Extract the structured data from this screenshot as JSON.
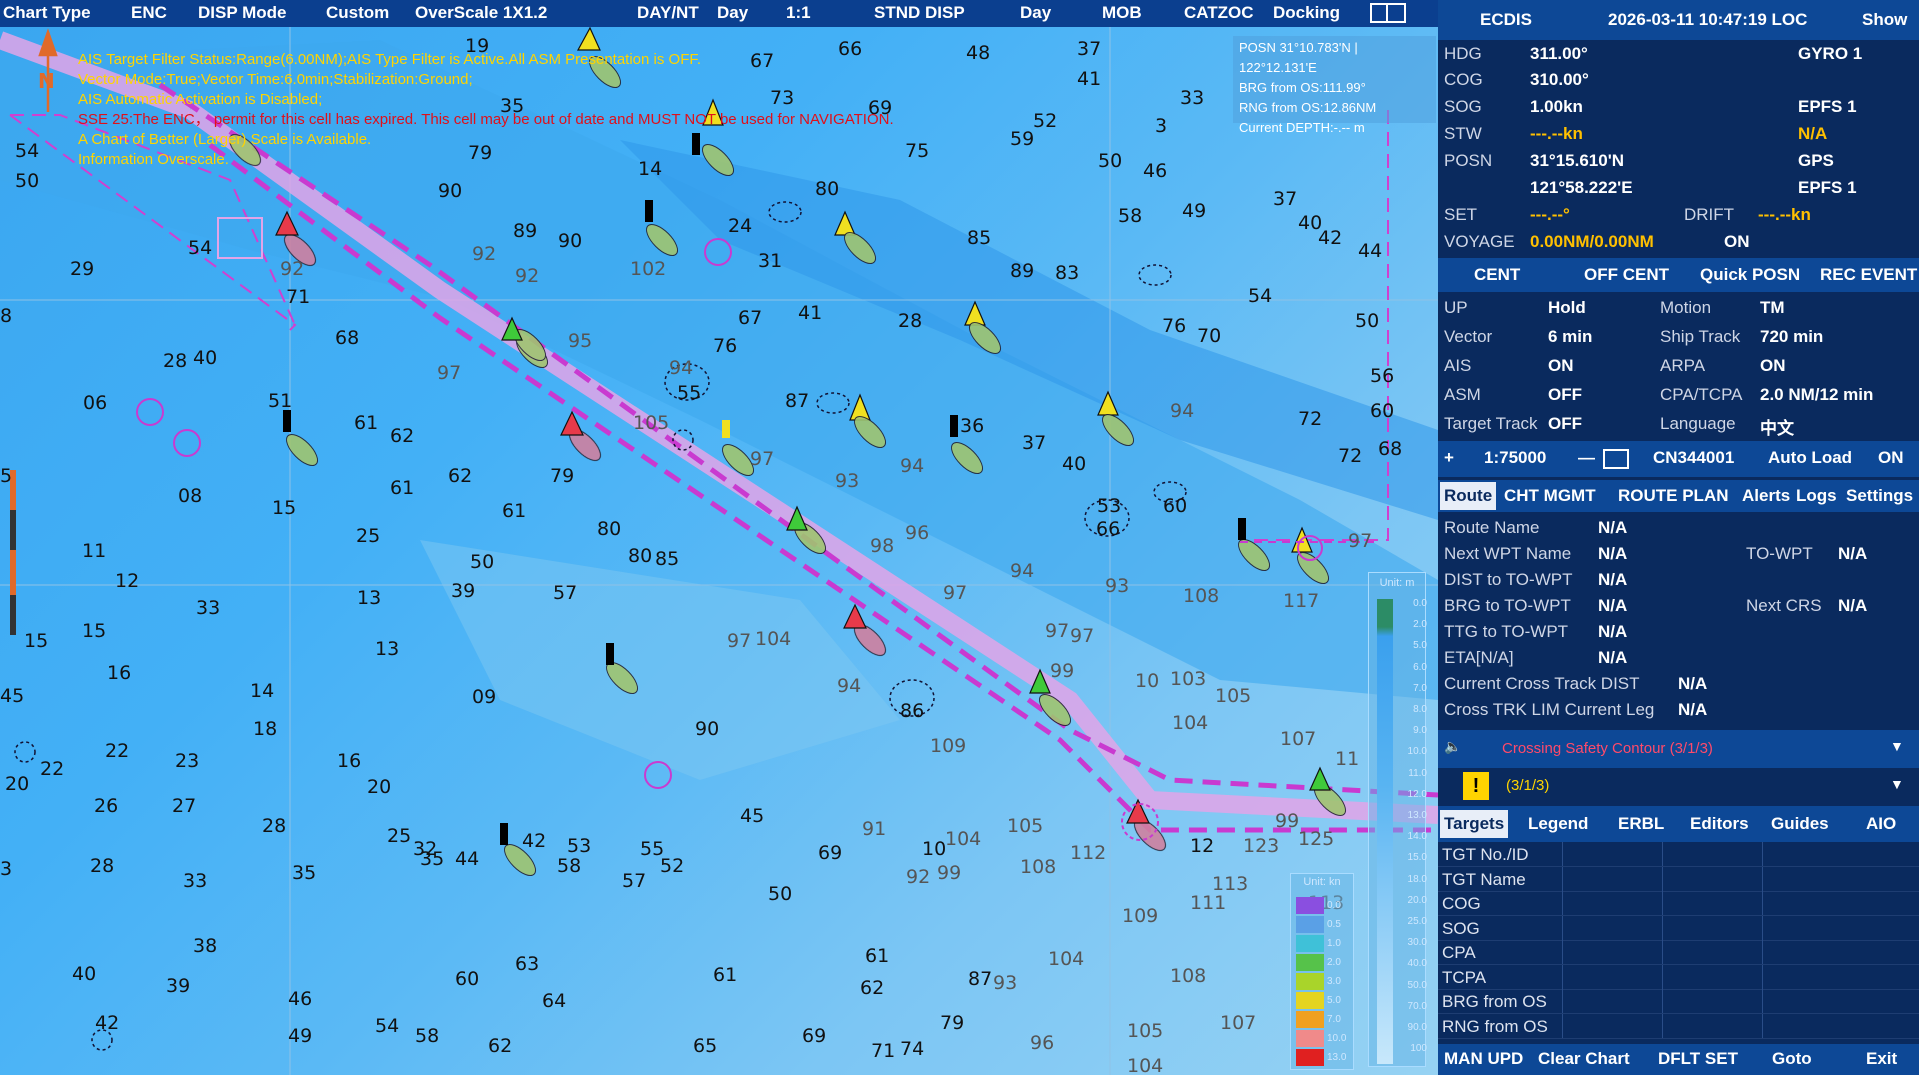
{
  "topbar": {
    "chart_type": "Chart Type",
    "enc": "ENC",
    "disp_mode": "DISP Mode",
    "custom": "Custom",
    "overscale": "OverScale 1X1.2",
    "day_nt": "DAY/NT",
    "day": "Day",
    "ratio": "1:1",
    "stnd_disp": "STND DISP",
    "day2": "Day",
    "mob": "MOB",
    "catzoc": "CATZOC",
    "docking": "Docking"
  },
  "messages": [
    "AIS Target Filter Status:Range(6.00NM);AIS Type Filter is Active.All ASM Presentation is OFF.",
    "Vector Mode:True;Vector Time:6.0min;Stabilization:Ground;",
    "AIS Automatic Activation is Disabled;",
    "SSE 25:The ENC，  permit for this cell has expired. This cell may be out of date and MUST NOT be used for NAVIGATION.",
    "A Chart of Better (Larger) Scale is Available.",
    "Information Overscale."
  ],
  "cursor_info": {
    "posn": "POSN 31°10.783'N | 122°12.131'E",
    "brg": "BRG from OS:111.99°",
    "rng": "RNG from OS:12.86NM",
    "depth": "Current DEPTH:-.-- m"
  },
  "panel": {
    "title": "ECDIS",
    "datetime": "2026-03-11 10:47:19 LOC",
    "show": "Show",
    "hdg_l": "HDG",
    "hdg_v": "311.00°",
    "hdg_src": "GYRO 1",
    "cog_l": "COG",
    "cog_v": "310.00°",
    "sog_l": "SOG",
    "sog_v": "1.00kn",
    "sog_src": "EPFS 1",
    "stw_l": "STW",
    "stw_v": "---.--kn",
    "stw_src": "N/A",
    "posn_l": "POSN",
    "lat": "31°15.610'N",
    "lat_src": "GPS",
    "lon": "121°58.222'E",
    "lon_src": "EPFS 1",
    "set_l": "SET",
    "set_v": "---.--°",
    "drift_l": "DRIFT",
    "drift_v": "---.--kn",
    "voyage_l": "VOYAGE",
    "voyage_v": "0.00NM/0.00NM",
    "voyage_on": "ON",
    "btn_cent": "CENT",
    "btn_offcent": "OFF CENT",
    "btn_quick": "Quick POSN",
    "btn_rec": "REC EVENT",
    "up_l": "UP",
    "up_v": "Hold",
    "motion_l": "Motion",
    "motion_v": "TM",
    "vector_l": "Vector",
    "vector_v": "6 min",
    "track_l": "Ship Track",
    "track_v": "720 min",
    "ais_l": "AIS",
    "ais_v": "ON",
    "arpa_l": "ARPA",
    "arpa_v": "ON",
    "asm_l": "ASM",
    "asm_v": "OFF",
    "cpa_l": "CPA/TCPA",
    "cpa_v": "2.0 NM/12 min",
    "tt_l": "Target Track",
    "tt_v": "OFF",
    "lang_l": "Language",
    "lang_v": "中文",
    "plus": "+",
    "scale": "1:75000",
    "minus": "—",
    "cell": "CN344001",
    "autoload": "Auto Load",
    "autoload_v": "ON",
    "tabs": [
      "Route",
      "CHT MGMT",
      "ROUTE PLAN",
      "Alerts",
      "Logs",
      "Settings"
    ],
    "route_name_l": "Route Name",
    "route_name_v": "N/A",
    "next_wpt_l": "Next WPT Name",
    "next_wpt_v": "N/A",
    "to_wpt_l": "TO-WPT",
    "to_wpt_v": "N/A",
    "dist_l": "DIST to TO-WPT",
    "dist_v": "N/A",
    "brg_l": "BRG to TO-WPT",
    "brg_v": "N/A",
    "next_crs_l": "Next CRS",
    "next_crs_v": "N/A",
    "ttg_l": "TTG to TO-WPT",
    "ttg_v": "N/A",
    "eta_l": "ETA[N/A]",
    "eta_v": "N/A",
    "xtd_l": "Current Cross Track DIST",
    "xtd_v": "N/A",
    "xtl_l": "Cross TRK LIM Current Leg",
    "xtl_v": "N/A",
    "alert1": "Crossing Safety Contour (3/1/3)",
    "alert2": "(3/1/3)",
    "tabs2": [
      "Targets",
      "Legend",
      "ERBL",
      "Editors",
      "Guides",
      "AIO"
    ],
    "tgt_rows": [
      "TGT No./ID",
      "TGT Name",
      "COG",
      "SOG",
      "CPA",
      "TCPA",
      "BRG from OS",
      "RNG from OS"
    ],
    "bottom": [
      "MAN UPD",
      "Clear Chart",
      "DFLT SET",
      "Goto",
      "Exit"
    ]
  },
  "depth_legend": {
    "unit": "Unit: m",
    "ticks": [
      "0.0",
      "2.0",
      "5.0",
      "6.0",
      "7.0",
      "8.0",
      "9.0",
      "10.0",
      "11.0",
      "12.0",
      "13.0",
      "14.0",
      "15.0",
      "18.0",
      "20.0",
      "25.0",
      "30.0",
      "40.0",
      "50.0",
      "70.0",
      "90.0",
      "100"
    ]
  },
  "speed_legend": {
    "unit": "Unit: kn",
    "ticks": [
      "0.0",
      "0.5",
      "1.0",
      "2.0",
      "3.0",
      "5.0",
      "7.0",
      "10.0",
      "13.0"
    ],
    "colors": [
      "#8a4fe0",
      "#5aa0e6",
      "#3fc1d8",
      "#56c24a",
      "#a9d42a",
      "#e4d420",
      "#f0a020",
      "#f08a8a",
      "#e02020"
    ]
  },
  "soundings": [
    [
      "54",
      15,
      140,
      0
    ],
    [
      "50",
      15,
      170,
      0
    ],
    [
      "29",
      70,
      258,
      0
    ],
    [
      "54",
      188,
      237,
      0
    ],
    [
      "71",
      286,
      286,
      0
    ],
    [
      "92",
      280,
      258,
      1
    ],
    [
      "8",
      0,
      305,
      0
    ],
    [
      "28",
      163,
      350,
      0
    ],
    [
      "40",
      193,
      347,
      0
    ],
    [
      "68",
      335,
      327,
      0
    ],
    [
      "06",
      83,
      392,
      0
    ],
    [
      "51",
      268,
      390,
      0
    ],
    [
      "61",
      354,
      412,
      0
    ],
    [
      "62",
      390,
      425,
      0
    ],
    [
      "61",
      390,
      477,
      0
    ],
    [
      "62",
      448,
      465,
      0
    ],
    [
      "08",
      178,
      485,
      0
    ],
    [
      "15",
      272,
      497,
      0
    ],
    [
      "61",
      502,
      500,
      0
    ],
    [
      "11",
      82,
      540,
      0
    ],
    [
      "12",
      115,
      570,
      0
    ],
    [
      "33",
      196,
      597,
      0
    ],
    [
      "25",
      356,
      525,
      0
    ],
    [
      "50",
      470,
      551,
      0
    ],
    [
      "39",
      451,
      580,
      0
    ],
    [
      "13",
      357,
      587,
      0
    ],
    [
      "57",
      553,
      582,
      0
    ],
    [
      "80",
      597,
      518,
      0
    ],
    [
      "80",
      628,
      545,
      0
    ],
    [
      "85",
      655,
      548,
      0
    ],
    [
      "15",
      24,
      630,
      0
    ],
    [
      "15",
      82,
      620,
      0
    ],
    [
      "16",
      107,
      662,
      0
    ],
    [
      "13",
      375,
      638,
      0
    ],
    [
      "14",
      250,
      680,
      0
    ],
    [
      "18",
      253,
      718,
      0
    ],
    [
      "09",
      472,
      686,
      0
    ],
    [
      "90",
      695,
      718,
      0
    ],
    [
      "97",
      727,
      630,
      1
    ],
    [
      "104",
      755,
      628,
      1
    ],
    [
      "94",
      837,
      675,
      1
    ],
    [
      "86",
      900,
      700,
      0
    ],
    [
      "109",
      930,
      735,
      1
    ],
    [
      "22",
      105,
      740,
      0
    ],
    [
      "23",
      175,
      750,
      0
    ],
    [
      "20",
      5,
      773,
      0
    ],
    [
      "22",
      40,
      758,
      0
    ],
    [
      "26",
      94,
      795,
      0
    ],
    [
      "27",
      172,
      795,
      0
    ],
    [
      "16",
      337,
      750,
      0
    ],
    [
      "20",
      367,
      776,
      0
    ],
    [
      "28",
      262,
      815,
      0
    ],
    [
      "25",
      387,
      825,
      0
    ],
    [
      "32",
      413,
      838,
      0
    ],
    [
      "35",
      420,
      848,
      0
    ],
    [
      "44",
      455,
      848,
      0
    ],
    [
      "42",
      522,
      830,
      0
    ],
    [
      "53",
      567,
      835,
      0
    ],
    [
      "58",
      557,
      855,
      0
    ],
    [
      "55",
      640,
      838,
      0
    ],
    [
      "52",
      660,
      855,
      0
    ],
    [
      "45",
      740,
      805,
      0
    ],
    [
      "69",
      818,
      842,
      0
    ],
    [
      "91",
      862,
      818,
      1
    ],
    [
      "10",
      922,
      838,
      0
    ],
    [
      "104",
      945,
      828,
      1
    ],
    [
      "105",
      1007,
      815,
      1
    ],
    [
      "28",
      90,
      855,
      0
    ],
    [
      "33",
      183,
      870,
      0
    ],
    [
      "35",
      292,
      862,
      0
    ],
    [
      "57",
      622,
      870,
      0
    ],
    [
      "50",
      768,
      883,
      0
    ],
    [
      "92",
      906,
      866,
      1
    ],
    [
      "99",
      937,
      862,
      1
    ],
    [
      "112",
      1070,
      842,
      1
    ],
    [
      "108",
      1020,
      856,
      1
    ],
    [
      "38",
      193,
      935,
      0
    ],
    [
      "40",
      72,
      963,
      0
    ],
    [
      "39",
      166,
      975,
      0
    ],
    [
      "60",
      455,
      968,
      0
    ],
    [
      "63",
      515,
      953,
      0
    ],
    [
      "64",
      542,
      990,
      0
    ],
    [
      "61",
      713,
      964,
      0
    ],
    [
      "61",
      865,
      945,
      0
    ],
    [
      "62",
      860,
      977,
      0
    ],
    [
      "87",
      968,
      968,
      0
    ],
    [
      "93",
      993,
      972,
      1
    ],
    [
      "104",
      1048,
      948,
      1
    ],
    [
      "108",
      1170,
      965,
      1
    ],
    [
      "46",
      288,
      988,
      0
    ],
    [
      "49",
      288,
      1025,
      0
    ],
    [
      "42",
      95,
      1012,
      0
    ],
    [
      "54",
      375,
      1015,
      0
    ],
    [
      "58",
      415,
      1025,
      0
    ],
    [
      "62",
      488,
      1035,
      0
    ],
    [
      "65",
      693,
      1035,
      0
    ],
    [
      "69",
      802,
      1025,
      0
    ],
    [
      "79",
      940,
      1012,
      0
    ],
    [
      "71",
      871,
      1040,
      0
    ],
    [
      "74",
      900,
      1038,
      0
    ],
    [
      "96",
      1030,
      1032,
      1
    ],
    [
      "105",
      1127,
      1020,
      1
    ],
    [
      "104",
      1127,
      1055,
      1
    ],
    [
      "107",
      1220,
      1012,
      1
    ],
    [
      "111",
      1190,
      892,
      1
    ],
    [
      "113",
      1212,
      873,
      1
    ],
    [
      "109",
      1122,
      905,
      1
    ],
    [
      "45",
      0,
      685,
      0
    ],
    [
      "5",
      0,
      465,
      0
    ],
    [
      "3",
      0,
      858,
      0
    ],
    [
      "19",
      465,
      35,
      0
    ],
    [
      "67",
      750,
      50,
      0
    ],
    [
      "66",
      838,
      38,
      0
    ],
    [
      "73",
      770,
      87,
      0
    ],
    [
      "69",
      868,
      97,
      0
    ],
    [
      "48",
      966,
      42,
      0
    ],
    [
      "37",
      1077,
      38,
      0
    ],
    [
      "41",
      1077,
      68,
      0
    ],
    [
      "33",
      1180,
      87,
      0
    ],
    [
      "35",
      500,
      95,
      0
    ],
    [
      "52",
      1033,
      110,
      0
    ],
    [
      "59",
      1010,
      128,
      0
    ],
    [
      "75",
      905,
      140,
      0
    ],
    [
      "79",
      468,
      142,
      0
    ],
    [
      "14",
      638,
      158,
      0
    ],
    [
      "50",
      1098,
      150,
      0
    ],
    [
      "46",
      1143,
      160,
      0
    ],
    [
      "80",
      815,
      178,
      0
    ],
    [
      "37",
      1273,
      188,
      0
    ],
    [
      "40",
      1298,
      212,
      0
    ],
    [
      "42",
      1318,
      227,
      0
    ],
    [
      "24",
      728,
      215,
      0
    ],
    [
      "49",
      1182,
      200,
      0
    ],
    [
      "58",
      1118,
      205,
      0
    ],
    [
      "85",
      967,
      227,
      0
    ],
    [
      "90",
      438,
      180,
      0
    ],
    [
      "89",
      513,
      220,
      0
    ],
    [
      "90",
      558,
      230,
      0
    ],
    [
      "92",
      472,
      243,
      1
    ],
    [
      "92",
      515,
      265,
      1
    ],
    [
      "102",
      630,
      258,
      1
    ],
    [
      "31",
      758,
      250,
      0
    ],
    [
      "89",
      1010,
      260,
      0
    ],
    [
      "83",
      1055,
      262,
      0
    ],
    [
      "44",
      1358,
      240,
      0
    ],
    [
      "54",
      1248,
      285,
      0
    ],
    [
      "41",
      798,
      302,
      0
    ],
    [
      "67",
      738,
      307,
      0
    ],
    [
      "28",
      898,
      310,
      0
    ],
    [
      "76",
      1162,
      315,
      0
    ],
    [
      "70",
      1197,
      325,
      0
    ],
    [
      "50",
      1355,
      310,
      0
    ],
    [
      "76",
      713,
      335,
      0
    ],
    [
      "95",
      568,
      330,
      1
    ],
    [
      "97",
      437,
      362,
      1
    ],
    [
      "56",
      1370,
      365,
      0
    ],
    [
      "60",
      1370,
      400,
      0
    ],
    [
      "72",
      1298,
      408,
      0
    ],
    [
      "68",
      1378,
      438,
      0
    ],
    [
      "72",
      1338,
      445,
      0
    ],
    [
      "94",
      1170,
      400,
      1
    ],
    [
      "94",
      669,
      357,
      1
    ],
    [
      "55",
      677,
      382,
      0
    ],
    [
      "87",
      785,
      390,
      0
    ],
    [
      "36",
      960,
      415,
      0
    ],
    [
      "37",
      1022,
      432,
      0
    ],
    [
      "40",
      1062,
      453,
      0
    ],
    [
      "105",
      633,
      412,
      1
    ],
    [
      "97",
      750,
      448,
      1
    ],
    [
      "79",
      550,
      465,
      0
    ],
    [
      "93",
      835,
      470,
      1
    ],
    [
      "94",
      900,
      455,
      1
    ],
    [
      "53",
      1097,
      495,
      0
    ],
    [
      "60",
      1163,
      495,
      0
    ],
    [
      "66",
      1096,
      518,
      0
    ],
    [
      "98",
      870,
      535,
      1
    ],
    [
      "96",
      905,
      522,
      1
    ],
    [
      "97",
      1348,
      530,
      1
    ],
    [
      "94",
      1010,
      560,
      1
    ],
    [
      "93",
      1105,
      575,
      1
    ],
    [
      "108",
      1183,
      585,
      1
    ],
    [
      "117",
      1283,
      590,
      1
    ],
    [
      "97",
      943,
      582,
      1
    ],
    [
      "97",
      1045,
      620,
      1
    ],
    [
      "97",
      1070,
      625,
      1
    ],
    [
      "99",
      1050,
      660,
      1
    ],
    [
      "103",
      1170,
      668,
      1
    ],
    [
      "105",
      1215,
      685,
      1
    ],
    [
      "104",
      1172,
      712,
      1
    ],
    [
      "107",
      1280,
      728,
      1
    ],
    [
      "11",
      1335,
      748,
      1
    ],
    [
      "12",
      1190,
      835,
      0
    ],
    [
      "123",
      1243,
      835,
      1
    ],
    [
      "125",
      1298,
      828,
      1
    ],
    [
      "113",
      1308,
      892,
      1
    ],
    [
      "10",
      1135,
      670,
      1
    ],
    [
      "99",
      1275,
      810,
      1
    ],
    [
      "3",
      1155,
      115,
      0
    ]
  ]
}
